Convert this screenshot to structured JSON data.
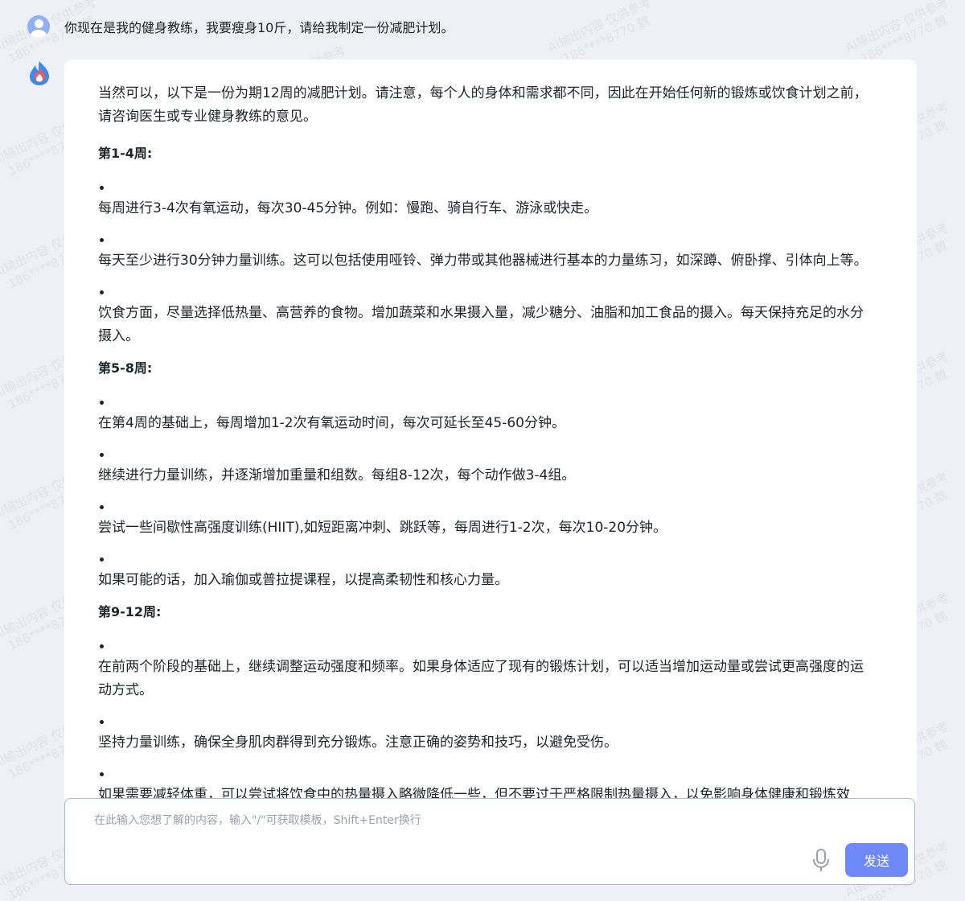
{
  "user_message": "你现在是我的健身教练，我要瘦身10斤，请给我制定一份减肥计划。",
  "answer": {
    "intro": "当然可以，以下是一份为期12周的减肥计划。请注意，每个人的身体和需求都不同，因此在开始任何新的锻炼或饮食计划之前，请咨询医生或专业健身教练的意见。",
    "sections": [
      {
        "title": "第1-4周:",
        "items": [
          "每周进行3-4次有氧运动，每次30-45分钟。例如：慢跑、骑自行车、游泳或快走。",
          "每天至少进行30分钟力量训练。这可以包括使用哑铃、弹力带或其他器械进行基本的力量练习，如深蹲、俯卧撑、引体向上等。",
          "饮食方面，尽量选择低热量、高营养的食物。增加蔬菜和水果摄入量，减少糖分、油脂和加工食品的摄入。每天保持充足的水分摄入。"
        ]
      },
      {
        "title": "第5-8周:",
        "items": [
          "在第4周的基础上，每周增加1-2次有氧运动时间，每次可延长至45-60分钟。",
          "继续进行力量训练，并逐渐增加重量和组数。每组8-12次，每个动作做3-4组。",
          "尝试一些间歇性高强度训练(HIIT),如短距离冲刺、跳跃等，每周进行1-2次，每次10-20分钟。",
          "如果可能的话，加入瑜伽或普拉提课程，以提高柔韧性和核心力量。"
        ]
      },
      {
        "title": "第9-12周:",
        "items": [
          "在前两个阶段的基础上，继续调整运动强度和频率。如果身体适应了现有的锻炼计划，可以适当增加运动量或尝试更高强度的运动方式。",
          "坚持力量训练，确保全身肌肉群得到充分锻炼。注意正确的姿势和技巧，以避免受伤。",
          "如果需要减轻体重，可以尝试将饮食中的热量摄入略微降低一些，但不要过于严格限制热量摄入，以免影响身体健康和锻炼效果。同时保证足够的蛋白质摄入，以帮助维持肌肉质量。"
        ]
      }
    ]
  },
  "input": {
    "placeholder": "在此输入您想了解的内容，输入\"/\"可获取模板，Shift+Enter换行"
  },
  "send_label": "发送",
  "watermark": {
    "line1": "AI输出内容 仅供参考",
    "line2": "186****8770 魏"
  },
  "colors": {
    "accent": "#6e89f5",
    "input_border": "#a9b5f0",
    "background": "#eef0f5"
  },
  "icons": {
    "user_avatar": "user-avatar-icon",
    "bot_avatar": "flame-drop-logo-icon",
    "mic": "microphone-icon"
  }
}
